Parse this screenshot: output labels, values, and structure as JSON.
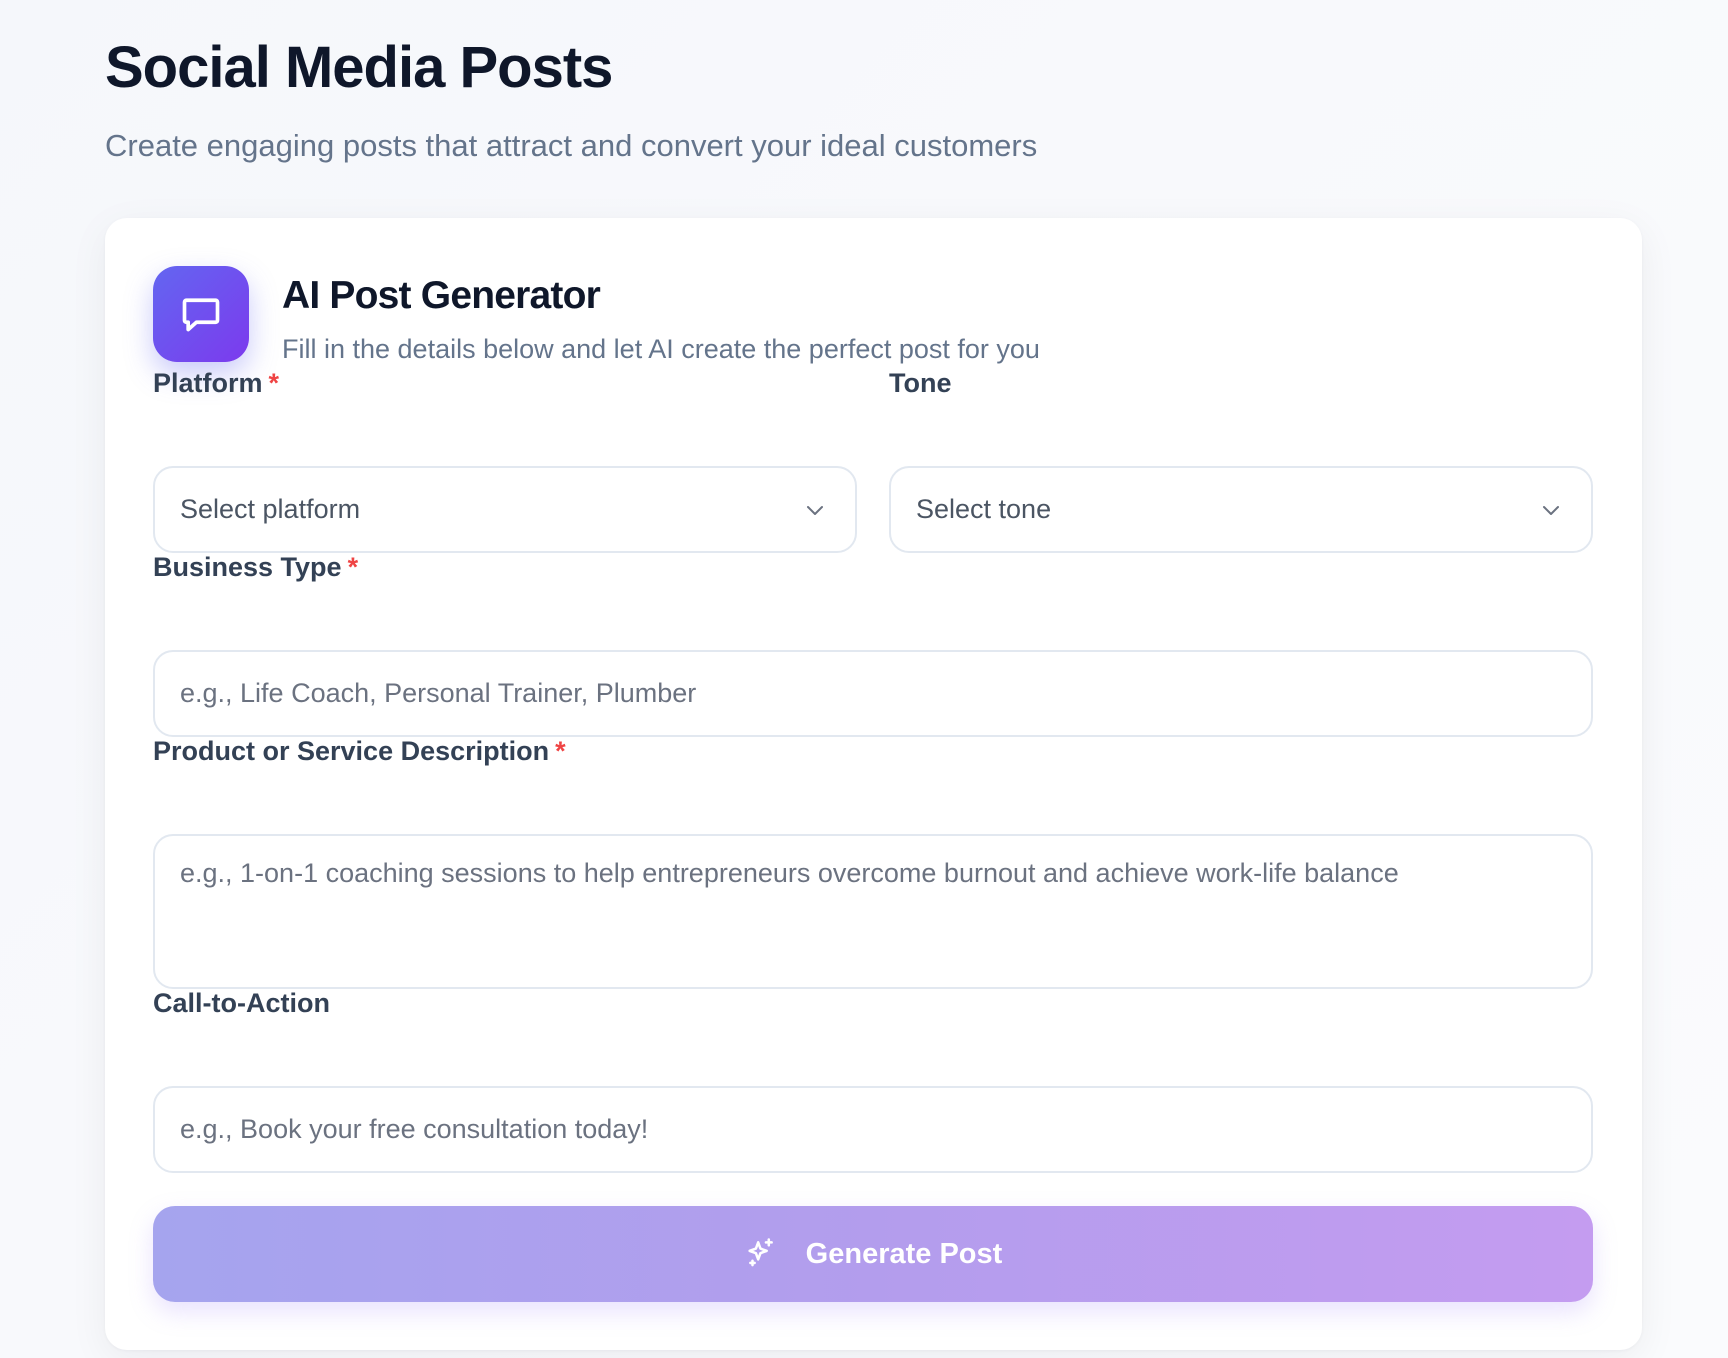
{
  "header": {
    "title": "Social Media Posts",
    "subtitle": "Create engaging posts that attract and convert your ideal customers"
  },
  "generator": {
    "icon": "chat-bubble-icon",
    "title": "AI Post Generator",
    "subtitle": "Fill in the details below and let AI create the perfect post for you"
  },
  "form": {
    "required_marker": "*",
    "platform": {
      "label": "Platform",
      "required": true,
      "placeholder": "Select platform"
    },
    "tone": {
      "label": "Tone",
      "required": false,
      "placeholder": "Select tone"
    },
    "business_type": {
      "label": "Business Type",
      "required": true,
      "placeholder": "e.g., Life Coach, Personal Trainer, Plumber",
      "value": ""
    },
    "description": {
      "label": "Product or Service Description",
      "required": true,
      "placeholder": "e.g., 1-on-1 coaching sessions to help entrepreneurs overcome burnout and achieve work-life balance",
      "value": ""
    },
    "cta": {
      "label": "Call-to-Action",
      "required": false,
      "placeholder": "e.g., Book your free consultation today!",
      "value": ""
    }
  },
  "generate_button": {
    "label": "Generate Post",
    "icon": "sparkles-icon"
  },
  "colors": {
    "accent_start": "#6366f1",
    "accent_end": "#7c3aed",
    "required": "#ef4444",
    "button_start": "#a5a4ee",
    "button_end": "#c49cf0"
  }
}
